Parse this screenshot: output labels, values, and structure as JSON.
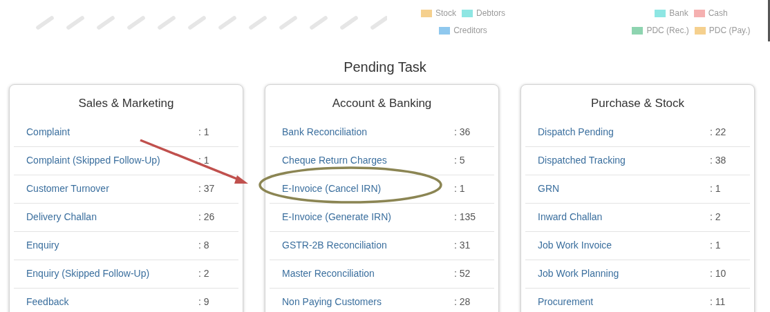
{
  "chart_legends": [
    {
      "rows": [
        [
          {
            "label": "Stock",
            "color": "#f5d08e"
          },
          {
            "label": "Debtors",
            "color": "#8ee6e3"
          }
        ],
        [
          {
            "label": "Creditors",
            "color": "#8fc8ee"
          }
        ]
      ]
    },
    {
      "rows": [
        [
          {
            "label": "Bank",
            "color": "#8ee6e3"
          },
          {
            "label": "Cash",
            "color": "#f5b0b0"
          }
        ],
        [
          {
            "label": "PDC (Rec.)",
            "color": "#8ed4b0"
          },
          {
            "label": "PDC (Pay.)",
            "color": "#f5d08e"
          }
        ]
      ]
    }
  ],
  "title": "Pending Task",
  "panels": [
    {
      "title": "Sales & Marketing",
      "items": [
        {
          "label": "Complaint",
          "count": ": 1"
        },
        {
          "label": "Complaint (Skipped Follow-Up)",
          "count": ": 1"
        },
        {
          "label": "Customer Turnover",
          "count": ": 37"
        },
        {
          "label": "Delivery Challan",
          "count": ": 26"
        },
        {
          "label": "Enquiry",
          "count": ": 8"
        },
        {
          "label": "Enquiry (Skipped Follow-Up)",
          "count": ": 2"
        },
        {
          "label": "Feedback",
          "count": ": 9"
        }
      ]
    },
    {
      "title": "Account & Banking",
      "items": [
        {
          "label": "Bank Reconciliation",
          "count": ": 36"
        },
        {
          "label": "Cheque Return Charges",
          "count": ": 5"
        },
        {
          "label": "E-Invoice (Cancel IRN)",
          "count": ": 1"
        },
        {
          "label": "E-Invoice (Generate IRN)",
          "count": ": 135"
        },
        {
          "label": "GSTR-2B Reconciliation",
          "count": ": 31"
        },
        {
          "label": "Master Reconciliation",
          "count": ": 52"
        },
        {
          "label": "Non Paying Customers",
          "count": ": 28"
        }
      ]
    },
    {
      "title": "Purchase & Stock",
      "items": [
        {
          "label": "Dispatch Pending",
          "count": ": 22"
        },
        {
          "label": "Dispatched Tracking",
          "count": ": 38"
        },
        {
          "label": "GRN",
          "count": ": 1"
        },
        {
          "label": "Inward Challan",
          "count": ": 2"
        },
        {
          "label": "Job Work Invoice",
          "count": ": 1"
        },
        {
          "label": "Job Work Planning",
          "count": ": 10"
        },
        {
          "label": "Procurement",
          "count": ": 11"
        }
      ]
    }
  ]
}
